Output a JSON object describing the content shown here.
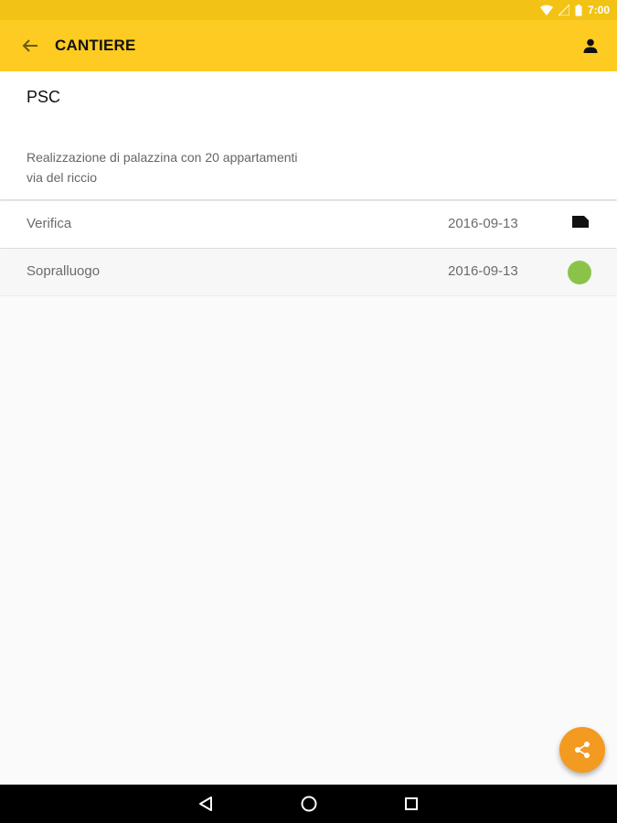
{
  "status_bar": {
    "time": "7:00",
    "icons": [
      "wifi-icon",
      "signal-icon",
      "battery-icon"
    ]
  },
  "app_bar": {
    "title": "CANTIERE",
    "back_icon": "arrow-back-icon",
    "account_icon": "person-icon",
    "color": "#fdcb22"
  },
  "site_card": {
    "name": "PSC",
    "description_lines": [
      "Realizzazione di palazzina con 20 appartamenti",
      "via del riccio"
    ]
  },
  "rows": [
    {
      "label": "Verifica",
      "date": "2016-09-13",
      "icon": "label-tag-icon"
    },
    {
      "label": "Sopralluogo",
      "date": "2016-09-13",
      "icon": "status-dot",
      "status_color": "#8bc34a"
    }
  ],
  "fab": {
    "icon": "share-icon",
    "color": "#f39a21"
  },
  "nav_bar": {
    "buttons": [
      "back-triangle-icon",
      "home-circle-icon",
      "recents-square-icon"
    ]
  }
}
